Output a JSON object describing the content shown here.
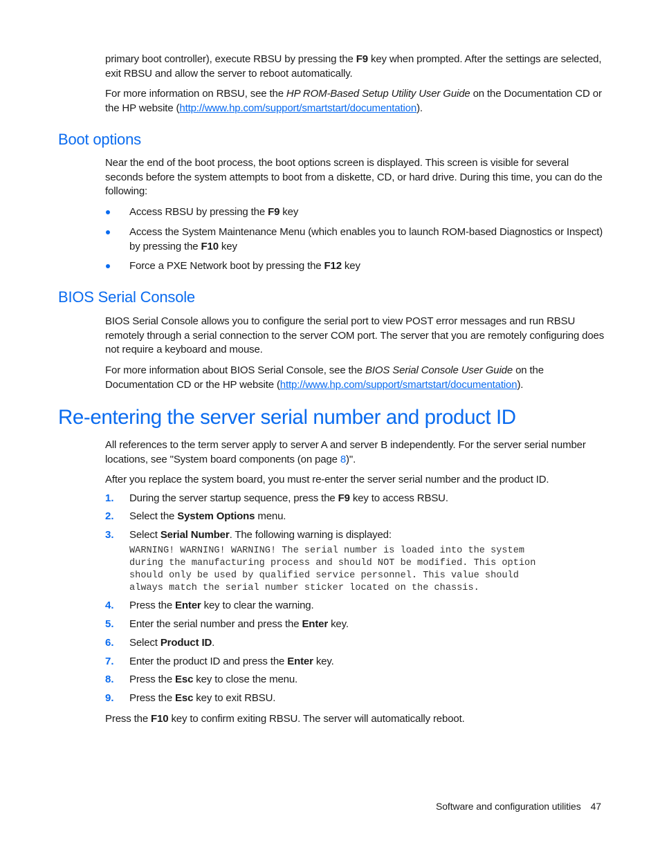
{
  "intro": {
    "p1": {
      "a": "primary boot controller), execute RBSU by pressing the ",
      "key": "F9",
      "b": " key when prompted. After the settings are selected, exit RBSU and allow the server to reboot automatically."
    },
    "p2": {
      "a": "For more information on RBSU, see the ",
      "guide": "HP ROM-Based Setup Utility User Guide",
      "b": " on the Documentation CD or the HP website (",
      "link": "http://www.hp.com/support/smartstart/documentation",
      "c": ")."
    }
  },
  "boot_options": {
    "heading": "Boot options",
    "intro": "Near the end of the boot process, the boot options screen is displayed. This screen is visible for several seconds before the system attempts to boot from a diskette, CD, or hard drive. During this time, you can do the following:",
    "bullets": [
      {
        "a": "Access RBSU by pressing the ",
        "key": "F9",
        "b": " key"
      },
      {
        "a": "Access the System Maintenance Menu (which enables you to launch ROM-based Diagnostics or Inspect) by pressing the ",
        "key": "F10",
        "b": " key"
      },
      {
        "a": "Force a PXE Network boot by pressing the ",
        "key": "F12",
        "b": " key"
      }
    ]
  },
  "bios_serial": {
    "heading": "BIOS Serial Console",
    "p1": "BIOS Serial Console allows you to configure the serial port to view POST error messages and run RBSU remotely through a serial connection to the server COM port. The server that you are remotely configuring does not require a keyboard and mouse.",
    "p2": {
      "a": "For more information about BIOS Serial Console, see the ",
      "guide": "BIOS Serial Console User Guide",
      "b": " on the Documentation CD or the HP website (",
      "link": "http://www.hp.com/support/smartstart/documentation",
      "c": ")."
    }
  },
  "reentering": {
    "heading": "Re-entering the server serial number and product ID",
    "p1": {
      "a": "All references to the term server apply to server A and server B independently. For the server serial number locations, see \"System board components (on page ",
      "page": "8",
      "b": ")\"."
    },
    "p2": "After you replace the system board, you must re-enter the server serial number and the product ID.",
    "steps": [
      {
        "num": "1.",
        "a": "During the server startup sequence, press the ",
        "bold": "F9",
        "b": " key to access RBSU."
      },
      {
        "num": "2.",
        "a": "Select the ",
        "bold": "System Options",
        "b": " menu."
      },
      {
        "num": "3.",
        "a": "Select ",
        "bold": "Serial Number",
        "b": ". The following warning is displayed:"
      },
      {
        "num": "4.",
        "a": "Press the ",
        "bold": "Enter",
        "b": " key to clear the warning."
      },
      {
        "num": "5.",
        "a": "Enter the serial number and press the ",
        "bold": "Enter",
        "b": " key."
      },
      {
        "num": "6.",
        "a": "Select ",
        "bold": "Product ID",
        "b": "."
      },
      {
        "num": "7.",
        "a": "Enter the product ID and press the ",
        "bold": "Enter",
        "b": " key."
      },
      {
        "num": "8.",
        "a": "Press the ",
        "bold": "Esc",
        "b": " key to close the menu."
      },
      {
        "num": "9.",
        "a": "Press the ",
        "bold": "Esc",
        "b": " key to exit RBSU."
      }
    ],
    "warning_lines": [
      "WARNING! WARNING! WARNING! The serial number is loaded into the system",
      "during the manufacturing process and should NOT be modified. This option",
      "should only be used by qualified service personnel. This value should",
      "always match the serial number sticker located on the chassis."
    ],
    "closing": {
      "a": "Press the ",
      "key": "F10",
      "b": " key to confirm exiting RBSU. The server will automatically reboot."
    }
  },
  "footer": {
    "section": "Software and configuration utilities",
    "page": "47"
  },
  "colors": {
    "accent": "#0a6bef",
    "text": "#1a1a1a"
  }
}
